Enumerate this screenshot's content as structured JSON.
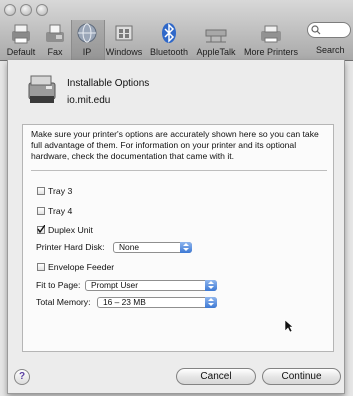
{
  "toolbar": {
    "items": [
      {
        "label": "Default",
        "icon": "default-printer-icon"
      },
      {
        "label": "Fax",
        "icon": "fax-icon"
      },
      {
        "label": "IP",
        "icon": "ip-globe-icon"
      },
      {
        "label": "Windows",
        "icon": "windows-icon"
      },
      {
        "label": "Bluetooth",
        "icon": "bluetooth-icon"
      },
      {
        "label": "AppleTalk",
        "icon": "appletalk-icon"
      },
      {
        "label": "More Printers",
        "icon": "more-printers-icon"
      },
      {
        "label": "Search",
        "icon": "search-icon"
      }
    ],
    "selected": "IP"
  },
  "sheet": {
    "title": "Installable Options",
    "host": "io.mit.edu",
    "description": "Make sure your printer's options are accurately shown here so you can take full advantage of them.  For information on your printer and its optional hardware, check the documentation that came with it.",
    "options": {
      "tray3": {
        "label": "Tray 3",
        "checked": false
      },
      "tray4": {
        "label": "Tray 4",
        "checked": false
      },
      "duplex": {
        "label": "Duplex Unit",
        "checked": true
      },
      "hard_disk": {
        "label": "Printer Hard Disk:",
        "value": "None"
      },
      "envelope": {
        "label": "Envelope Feeder",
        "checked": false
      },
      "fit_to_page": {
        "label": "Fit to Page:",
        "value": "Prompt User"
      },
      "memory": {
        "label": "Total Memory:",
        "value": "16 – 23 MB"
      }
    },
    "help_glyph": "?",
    "cancel_label": "Cancel",
    "continue_label": "Continue"
  },
  "colors": {
    "accent": "#3d79d4",
    "help": "#5a3ea3"
  }
}
